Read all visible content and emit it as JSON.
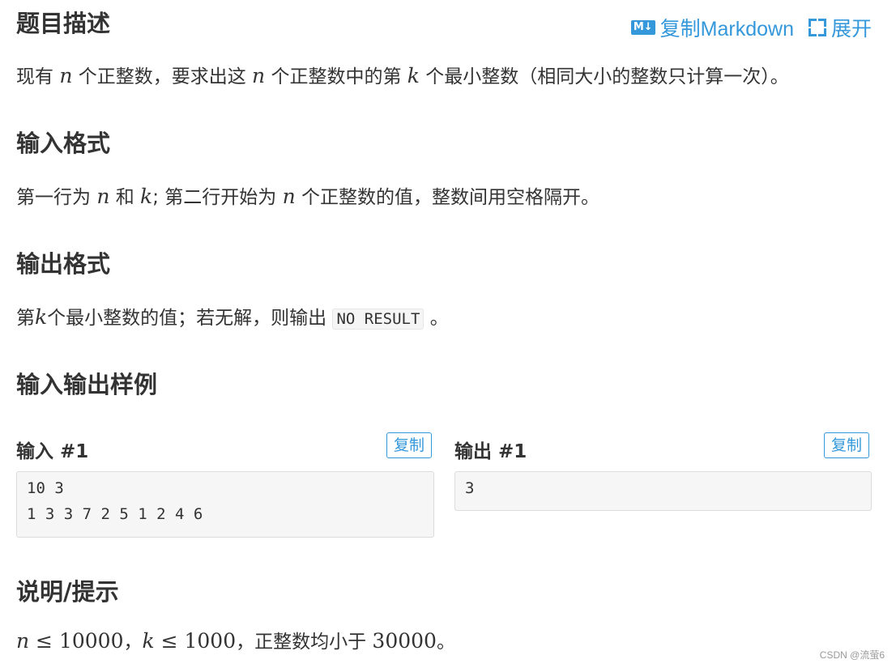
{
  "problem": {
    "section_title": "题目描述",
    "description": {
      "p1": "现有 ",
      "m1": "n",
      "p2": " 个正整数，要求出这 ",
      "m2": "n",
      "p3": " 个正整数中的第 ",
      "m3": "k",
      "p4": " 个最小整数（相同大小的整数只计算一次）。"
    }
  },
  "toolbar": {
    "md_badge": "M↓",
    "copy_markdown_label": "复制Markdown",
    "expand_label": "展开"
  },
  "input_format": {
    "title": "输入格式",
    "p1": "第一行为 ",
    "m1": "n",
    "p2": " 和 ",
    "m2": "k",
    "p3": "; 第二行开始为 ",
    "m3": "n",
    "p4": " 个正整数的值，整数间用空格隔开。"
  },
  "output_format": {
    "title": "输出格式",
    "p1": "第",
    "m1": "k",
    "p2": "个最小整数的值；若无解，则输出 ",
    "code": "NO RESULT",
    "p3": " 。"
  },
  "samples": {
    "title": "输入输出样例",
    "input": {
      "label": "输入 #1",
      "copy_label": "复制",
      "lines": [
        "10 3",
        "1 3 3 7 2 5 1 2 4 6"
      ]
    },
    "output": {
      "label": "输出 #1",
      "copy_label": "复制",
      "lines": [
        "3"
      ]
    }
  },
  "hint": {
    "title": "说明/提示",
    "m1": "n",
    "op1": " ≤ ",
    "v1": "10000",
    "sep1": "，",
    "m2": "k",
    "op2": " ≤ ",
    "v2": "1000",
    "p1": "，正整数均小于 ",
    "v3": "30000",
    "p2": "。"
  },
  "watermark": "CSDN @流萤6",
  "colors": {
    "accent": "#3498db",
    "text": "#333333",
    "code_bg": "#f6f6f6"
  }
}
